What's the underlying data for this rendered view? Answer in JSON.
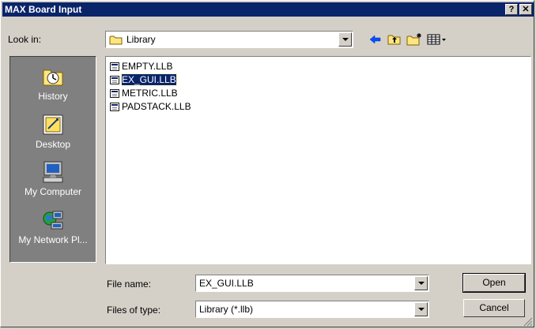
{
  "window": {
    "title": "MAX Board Input",
    "help_glyph": "?",
    "close_glyph": "✕"
  },
  "look_in": {
    "label": "Look in:",
    "value": "Library"
  },
  "toolbar": {
    "back_icon": "back-arrow-icon",
    "up_icon": "up-folder-icon",
    "new_folder_icon": "new-folder-icon",
    "view_icon": "view-menu-icon"
  },
  "places": [
    {
      "label": "History",
      "icon": "history-icon"
    },
    {
      "label": "Desktop",
      "icon": "desktop-icon"
    },
    {
      "label": "My Computer",
      "icon": "my-computer-icon"
    },
    {
      "label": "My Network Pl...",
      "icon": "network-places-icon"
    }
  ],
  "files": [
    {
      "name": "EMPTY.LLB",
      "selected": false
    },
    {
      "name": "EX_GUI.LLB",
      "selected": true
    },
    {
      "name": "METRIC.LLB",
      "selected": false
    },
    {
      "name": "PADSTACK.LLB",
      "selected": false
    }
  ],
  "file_name": {
    "label": "File name:",
    "value": "EX_GUI.LLB"
  },
  "file_type": {
    "label": "Files of type:",
    "value": "Library (*.llb)"
  },
  "buttons": {
    "open": "Open",
    "cancel": "Cancel"
  },
  "colors": {
    "title_bg": "#0a246a",
    "dialog_bg": "#d4d0c8",
    "places_bg": "#808080",
    "selection": "#0a246a"
  }
}
